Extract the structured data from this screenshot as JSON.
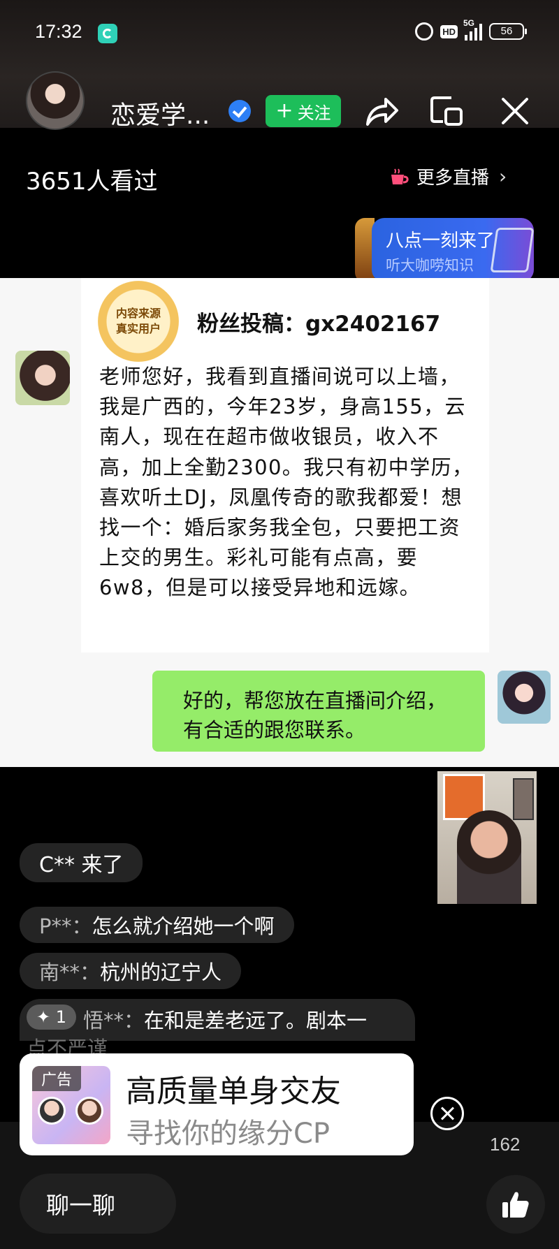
{
  "status": {
    "time": "17:32",
    "network": "5G",
    "hd": "HD",
    "battery": "56"
  },
  "header": {
    "streamer_name": "恋爱学...",
    "follow_label": "关注"
  },
  "live": {
    "viewers": "3651人看过",
    "more_live": "更多直播"
  },
  "promo": {
    "title": "八点一刻来了",
    "subtitle": "听大咖唠知识"
  },
  "chat_card": {
    "badge_line1": "内容来源",
    "badge_line2": "真实用户",
    "submission": "粉丝投稿：gx2402167",
    "fan_message": "老师您好，我看到直播间说可以上墙，我是广西的，今年23岁，身高155，云南人，现在在超市做收银员，收入不高，加上全勤2300。我只有初中学历，喜欢听土DJ，凤凰传奇的歌我都爱！想找一个：婚后家务我全包，只要把工资上交的男生。彩礼可能有点高，要6w8，但是可以接受异地和远嫁。",
    "reply_line1": "好的，帮您放在直播间介绍，",
    "reply_line2": "有合适的跟您联系。"
  },
  "comments": {
    "enter_notice": "C** 来了",
    "items": [
      {
        "user": "P**：",
        "text": "怎么就介绍她一个啊"
      },
      {
        "user": "南**：",
        "text": "杭州的辽宁人"
      },
      {
        "badge": "✦ 1",
        "user": "悟**：",
        "text": "在和是差老远了。剧本一",
        "overflow": "点不严谨"
      }
    ]
  },
  "ad": {
    "label": "广告",
    "title": "高质量单身交友",
    "subtitle": "寻找你的缘分CP"
  },
  "likes": "162",
  "bottom": {
    "chat_placeholder": "聊一聊"
  },
  "colors": {
    "follow_green": "#1dbe5a",
    "reply_bubble": "#95ec69",
    "verified_blue": "#2d7ff5",
    "promo_blue": "#3a6af0"
  },
  "icons": [
    "share-icon",
    "pip-icon",
    "close-icon",
    "verified-icon",
    "cup-icon",
    "thumbs-up-icon",
    "ad-close-icon"
  ]
}
